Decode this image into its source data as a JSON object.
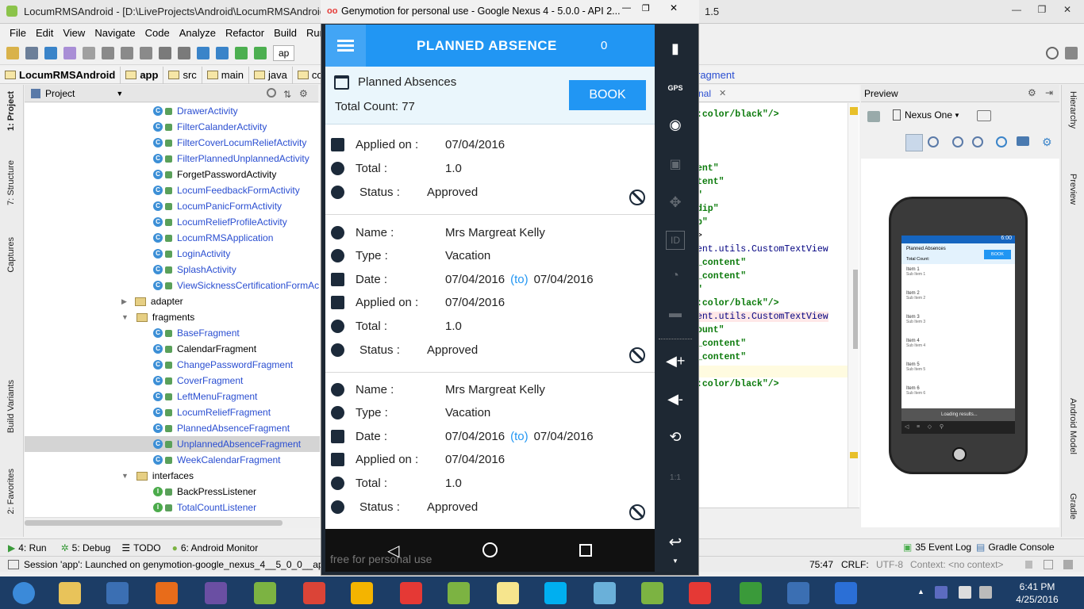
{
  "ide": {
    "title": "LocumRMSAndroid - [D:\\LiveProjects\\Android\\LocumRMSAndroid] - [a",
    "title_tail": "1.5",
    "menu": [
      "File",
      "Edit",
      "View",
      "Navigate",
      "Code",
      "Analyze",
      "Refactor",
      "Build",
      "Run",
      "T"
    ],
    "run_config": "ap",
    "breadcrumbs": [
      "LocumRMSAndroid",
      "app",
      "src",
      "main",
      "java",
      "co"
    ],
    "breadcrumb_right": "ragment",
    "project_panel_label": "Project",
    "side_tabs": [
      "1: Project",
      "7: Structure",
      "Captures",
      "Build Variants",
      "2: Favorites"
    ],
    "right_tabs": [
      "Gradle",
      "Android Model",
      "Preview",
      "Hierarchy"
    ],
    "tree": [
      {
        "label": "DrawerActivity",
        "kind": "class",
        "blue": true
      },
      {
        "label": "FilterCalanderActivity",
        "kind": "class",
        "blue": true
      },
      {
        "label": "FilterCoverLocumReliefActivity",
        "kind": "class",
        "blue": true
      },
      {
        "label": "FilterPlannedUnplannedActivity",
        "kind": "class",
        "blue": true
      },
      {
        "label": "ForgetPasswordActivity",
        "kind": "class",
        "blue": false
      },
      {
        "label": "LocumFeedbackFormActivity",
        "kind": "class",
        "blue": true
      },
      {
        "label": "LocumPanicFormActivity",
        "kind": "class",
        "blue": true
      },
      {
        "label": "LocumReliefProfileActivity",
        "kind": "class",
        "blue": true
      },
      {
        "label": "LocumRMSApplication",
        "kind": "class",
        "blue": true
      },
      {
        "label": "LoginActivity",
        "kind": "class",
        "blue": true
      },
      {
        "label": "SplashActivity",
        "kind": "class",
        "blue": true
      },
      {
        "label": "ViewSicknessCertificationFormAc",
        "kind": "class",
        "blue": true
      },
      {
        "label": "adapter",
        "kind": "folder",
        "blue": false
      },
      {
        "label": "fragments",
        "kind": "folder",
        "blue": false
      },
      {
        "label": "BaseFragment",
        "kind": "class",
        "blue": true
      },
      {
        "label": "CalendarFragment",
        "kind": "class",
        "blue": false
      },
      {
        "label": "ChangePasswordFragment",
        "kind": "class",
        "blue": true
      },
      {
        "label": "CoverFragment",
        "kind": "class",
        "blue": true
      },
      {
        "label": "LeftMenuFragment",
        "kind": "class",
        "blue": true
      },
      {
        "label": "LocumReliefFragment",
        "kind": "class",
        "blue": true
      },
      {
        "label": "PlannedAbsenceFragment",
        "kind": "class",
        "blue": true
      },
      {
        "label": "UnplannedAbsenceFragment",
        "kind": "class",
        "blue": true,
        "selected": true
      },
      {
        "label": "WeekCalendarFragment",
        "kind": "class",
        "blue": true
      },
      {
        "label": "interfaces",
        "kind": "folder",
        "blue": false
      },
      {
        "label": "BackPressListener",
        "kind": "interface",
        "blue": false
      },
      {
        "label": "TotalCountListener",
        "kind": "interface",
        "blue": true
      }
    ],
    "editor_tab": "nal",
    "editor_lines": [
      {
        "text": ":color/black\"/>",
        "kind": "str"
      },
      {
        "text": "ent\"",
        "kind": "str"
      },
      {
        "text": "tent\"",
        "kind": "str"
      },
      {
        "text": "\"",
        "kind": "str"
      },
      {
        "text": "dip\"",
        "kind": "str"
      },
      {
        "text": "p\"",
        "kind": "str"
      },
      {
        "text": ">",
        "kind": "plain"
      },
      {
        "text": "ent.utils.CustomTextView",
        "kind": "tag"
      },
      {
        "text": "_content\"",
        "kind": "str"
      },
      {
        "text": "_content\"",
        "kind": "str"
      },
      {
        "text": "\"",
        "kind": "str"
      },
      {
        "text": ":color/black\"/>",
        "kind": "str"
      },
      {
        "text": "ent.utils.CustomTextView",
        "kind": "tag"
      },
      {
        "text": "ount\"",
        "kind": "str"
      },
      {
        "text": "_content\"",
        "kind": "str"
      },
      {
        "text": "_content\"",
        "kind": "str"
      },
      {
        "text": "",
        "kind": "plain"
      },
      {
        "text": ":color/black\"/>",
        "kind": "str"
      }
    ],
    "preview": {
      "label": "Preview",
      "device": "Nexus One",
      "phone_header": "Planned Absences",
      "phone_total": "Total Count:",
      "phone_book": "BOOK",
      "phone_time": "6:00",
      "phone_items": [
        {
          "title": "Item 1",
          "sub": "Sub Item 1"
        },
        {
          "title": "Item 2",
          "sub": "Sub Item 2"
        },
        {
          "title": "Item 3",
          "sub": "Sub Item 3"
        },
        {
          "title": "Item 4",
          "sub": "Sub Item 4"
        },
        {
          "title": "Item 5",
          "sub": "Sub Item 5"
        },
        {
          "title": "Item 6",
          "sub": "Sub Item 6"
        }
      ],
      "loading": "Loading results..."
    },
    "bottom_tabs": [
      "4: Run",
      "5: Debug",
      "TODO",
      "6: Android Monitor"
    ],
    "bottom_right_tabs": [
      "35 Event Log",
      "Gradle Console"
    ],
    "status_text": "Session 'app': Launched on genymotion-google_nexus_4__5_0_0__ap",
    "status_right": {
      "pos": "75:47",
      "crlf": "CRLF:",
      "encoding": "UTF-8",
      "context": "Context: <no context>"
    }
  },
  "genymotion": {
    "title": "Genymotion for personal use - Google Nexus 4 - 5.0.0 - API 2...",
    "watermark": "free for personal use",
    "side_icons": [
      "battery-icon",
      "gps-icon",
      "camera-icon",
      "video-icon",
      "dpad-icon",
      "id-icon",
      "rss-icon",
      "sms-icon",
      "volume-up-icon",
      "volume-down-icon",
      "rotate-icon",
      "scale-icon",
      "back-arrow-icon"
    ],
    "gps_label": "GPS",
    "id_label": "ID",
    "scale_label": "1:1"
  },
  "app": {
    "title": "PLANNED ABSENCE",
    "badge": "0",
    "header": "Planned Absences",
    "total": "Total Count: 77",
    "book": "BOOK",
    "partial_card": [
      {
        "label": "Applied on :",
        "value": "07/04/2016"
      },
      {
        "label": "Total :",
        "value": "1.0"
      },
      {
        "label": "Status :",
        "value": "Approved"
      }
    ],
    "cards": [
      {
        "name_label": "Name :",
        "name": "Mrs Margreat Kelly",
        "type_label": "Type :",
        "type": "Vacation",
        "date_label": "Date :",
        "date_from": "07/04/2016",
        "date_sep": "(to)",
        "date_to": "07/04/2016",
        "applied_label": "Applied on :",
        "applied": "07/04/2016",
        "total_label": "Total :",
        "total": "1.0",
        "status_label": "Status :",
        "status": "Approved"
      },
      {
        "name_label": "Name :",
        "name": "Mrs Margreat Kelly",
        "type_label": "Type :",
        "type": "Vacation",
        "date_label": "Date :",
        "date_from": "07/04/2016",
        "date_sep": "(to)",
        "date_to": "07/04/2016",
        "applied_label": "Applied on :",
        "applied": "07/04/2016",
        "total_label": "Total :",
        "total": "1.0",
        "status_label": "Status :",
        "status": "Approved"
      }
    ]
  },
  "taskbar": {
    "time": "6:41 PM",
    "date": "4/25/2016",
    "apps": [
      "start",
      "file-explorer",
      "media-player",
      "firefox",
      "eclipse",
      "android-studio",
      "chrome",
      "calculator",
      "genymotion",
      "notepad-plus",
      "sticky-notes",
      "skype",
      "editor",
      "android-studio-2",
      "genymotion-2",
      "spreadsheet",
      "text-editor",
      "upload"
    ]
  },
  "colors": {
    "accent": "#2196f3",
    "appbar_dark": "#42a5f5",
    "panel": "#1e2833",
    "taskbar": "#1c3d66"
  }
}
